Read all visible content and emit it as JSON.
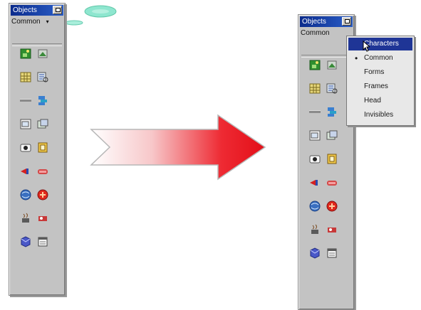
{
  "left_palette": {
    "title": "Objects",
    "category": "Common",
    "dropdown_arrow": "▾",
    "icons": [
      "image-icon",
      "image-placeholder-icon",
      "table-icon",
      "tabular-data-icon",
      "horizontal-rule-icon",
      "navigation-bar-icon",
      "layer-icon",
      "rollover-image-icon",
      "flash-icon",
      "shockwave-icon",
      "fireworks-icon",
      "generator-icon",
      "server-side-include-icon",
      "activex-icon",
      "java-applet-icon",
      "plugin-icon",
      "email-link-icon",
      "date-icon"
    ]
  },
  "right_palette": {
    "title": "Objects",
    "category": "Common",
    "dropdown_arrow": "▾",
    "menu": {
      "items": [
        {
          "label": "Characters",
          "selected": true
        },
        {
          "label": "Common",
          "checked": true
        },
        {
          "label": "Forms"
        },
        {
          "label": "Frames"
        },
        {
          "label": "Head"
        },
        {
          "label": "Invisibles"
        }
      ],
      "bullet": "•"
    }
  },
  "colors": {
    "title_bar": "#0b2b8c",
    "menu_selection": "#1f3596",
    "arrow_red": "#e8101a",
    "palette_bg": "#c3c3c3",
    "cloud": "#7ee0c6"
  }
}
